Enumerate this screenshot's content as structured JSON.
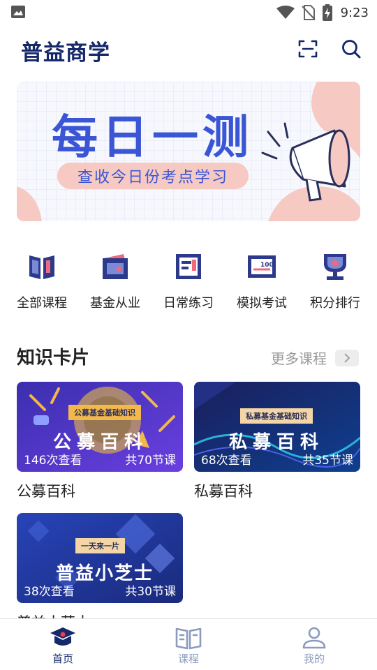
{
  "status_bar": {
    "time": "9:23",
    "icons": [
      "image-icon",
      "wifi-icon",
      "no-sim-icon",
      "battery-charging-icon"
    ]
  },
  "header": {
    "title": "普益商学",
    "icons": [
      "scan-icon",
      "search-icon"
    ]
  },
  "banner": {
    "title": "每日一测",
    "subtitle": "查收今日份考点学习",
    "colors": {
      "accent": "#3a56d4",
      "pink": "#f7c9c3"
    }
  },
  "menu": {
    "items": [
      {
        "label": "全部课程",
        "icon": "book-icon"
      },
      {
        "label": "基金从业",
        "icon": "wallet-icon"
      },
      {
        "label": "日常练习",
        "icon": "practice-icon"
      },
      {
        "label": "模拟考试",
        "icon": "exam-icon"
      },
      {
        "label": "积分排行",
        "icon": "trophy-icon"
      }
    ]
  },
  "section": {
    "title": "知识卡片",
    "more_label": "更多课程"
  },
  "cards": [
    {
      "tag": "公募基金基础知识",
      "big_text": "公募百科",
      "views": "146次查看",
      "lessons": "共70节课",
      "title": "公募百科"
    },
    {
      "tag": "私募基金基础知识",
      "big_text": "私募百科",
      "views": "68次查看",
      "lessons": "共35节课",
      "title": "私募百科"
    },
    {
      "tag": "一天来一片",
      "big_text": "普益小芝士",
      "views": "38次查看",
      "lessons": "共30节课",
      "title": "普益小芝士"
    }
  ],
  "bottom_nav": {
    "items": [
      {
        "label": "首页",
        "icon": "home-icon",
        "active": true
      },
      {
        "label": "课程",
        "icon": "course-book-icon",
        "active": false
      },
      {
        "label": "我的",
        "icon": "profile-icon",
        "active": false
      }
    ],
    "active_color": "#14286a",
    "inactive_color": "#8a9bc0"
  }
}
